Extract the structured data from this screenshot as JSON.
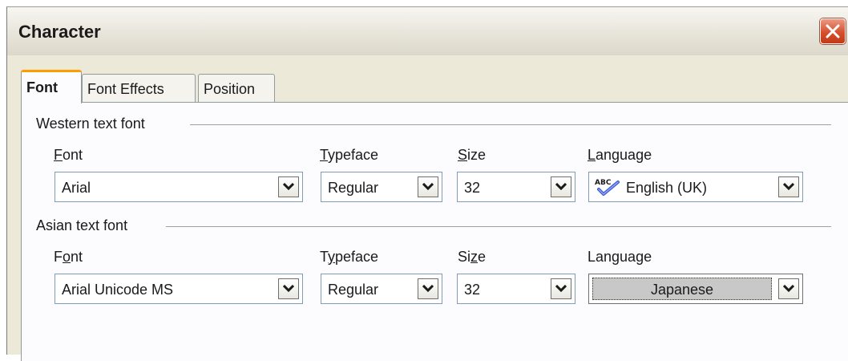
{
  "window": {
    "title": "Character"
  },
  "tabs": [
    {
      "label": "Font",
      "active": true
    },
    {
      "label": "Font Effects",
      "active": false
    },
    {
      "label": "Position",
      "active": false
    }
  ],
  "western": {
    "section_title": "Western text font",
    "labels": {
      "font_rest": "ont",
      "font_key": "F",
      "typeface_key": "T",
      "typeface_rest": "ypeface",
      "size_key": "S",
      "size_rest": "ize",
      "language_key": "L",
      "language_rest": "anguage"
    },
    "font": "Arial",
    "typeface": "Regular",
    "size": "32",
    "language": "English (UK)",
    "language_icon": "spellcheck-abc-icon"
  },
  "asian": {
    "section_title": "Asian text font",
    "labels": {
      "font_pre": "F",
      "font_key": "o",
      "font_rest": "nt",
      "typeface_pre": "T",
      "typeface_key": "y",
      "typeface_rest": "peface",
      "size_pre": "Si",
      "size_key": "z",
      "size_rest": "e",
      "language": "Language"
    },
    "font": "Arial Unicode MS",
    "typeface": "Regular",
    "size": "32",
    "language": "Japanese"
  },
  "colors": {
    "dialog_bg": "#ece9d8",
    "active_tab_accent": "#ff9c00",
    "close_button": "#d5502e",
    "field_border": "#7f9db9"
  }
}
